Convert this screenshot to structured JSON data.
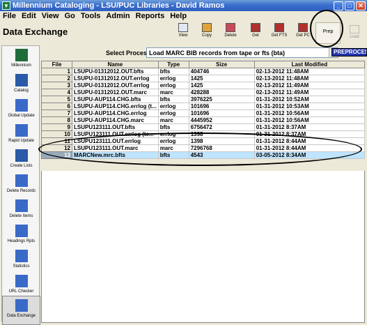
{
  "window": {
    "title": "Millennium Cataloging - LSU/PUC Libraries - David Ramos",
    "min": "_",
    "max": "□",
    "close": "✕"
  },
  "menu": [
    "File",
    "Edit",
    "View",
    "Go",
    "Tools",
    "Admin",
    "Reports",
    "Help"
  ],
  "page_title": "Data Exchange",
  "toolbar": [
    {
      "label": "View",
      "color": "#dfe8f4"
    },
    {
      "label": "Copy",
      "color": "#e0a33a"
    },
    {
      "label": "Delete",
      "color": "#c84a5a"
    },
    {
      "label": "Get",
      "color": "#b03030"
    },
    {
      "label": "Get FTS",
      "color": "#b03030"
    },
    {
      "label": "Get PC",
      "color": "#b03030"
    }
  ],
  "prep_label": "Prep",
  "load_label": "Load",
  "select_process": {
    "label": "Select Process",
    "value": "Load MARC BIB records from tape or fts (bta)"
  },
  "preprocess_badge": "PREPROCESS",
  "sidebar": [
    {
      "label": "Millennium",
      "color": "#1f6b3a"
    },
    {
      "label": "Catalog",
      "color": "#2a5aa8"
    },
    {
      "label": "Global Update",
      "color": "#3a6ac8"
    },
    {
      "label": "Rapid Update",
      "color": "#3a6ac8"
    },
    {
      "label": "Create Lists",
      "color": "#2a5aa8"
    },
    {
      "label": "Delete Records",
      "color": "#3a6ac8"
    },
    {
      "label": "Delete Items",
      "color": "#3a6ac8"
    },
    {
      "label": "Headings Rpts",
      "color": "#3a6ac8"
    },
    {
      "label": "Statistics",
      "color": "#3a6ac8"
    },
    {
      "label": "URL Checker",
      "color": "#3a6ac8"
    },
    {
      "label": "Data Exchange",
      "color": "#3a6ac8"
    }
  ],
  "table": {
    "headers": [
      "File",
      "Name",
      "Type",
      "Size",
      "Last Modified"
    ],
    "rows": [
      [
        "1",
        "LSUPU-01312012.OUT.bfts",
        "bfts",
        "404746",
        "02-13-2012 11:48AM"
      ],
      [
        "2",
        "LSUPU-01312012.OUT.errlog",
        "errlog",
        "1425",
        "02-13-2012 11:48AM"
      ],
      [
        "3",
        "LSUPU-01312012.OUT.errlog",
        "errlog",
        "1425",
        "02-13-2012 11:49AM"
      ],
      [
        "4",
        "LSUPU-01312012.OUT.marc",
        "marc",
        "428288",
        "02-13-2012 11:49AM"
      ],
      [
        "5",
        "LSUPU-AUP114.CHG.bfts",
        "bfts",
        "3976225",
        "01-31-2012 10:52AM"
      ],
      [
        "6",
        "LSUPU-AUP114.CHG.errlog (t...",
        "errlog",
        "101696",
        "01-31-2012 10:53AM"
      ],
      [
        "7",
        "LSUPU-AUP114.CHG.errlog",
        "errlog",
        "101696",
        "01-31-2012 10:56AM"
      ],
      [
        "8",
        "LSUPU-AUP114.CHG.marc",
        "marc",
        "4445952",
        "01-31-2012 10:56AM"
      ],
      [
        "9",
        "LSUPU123111.OUT.bfts",
        "bfts",
        "6756472",
        "01-31-2012 8:37AM"
      ],
      [
        "10",
        "LSUPU123111.OUT.errlog (te...",
        "errlog",
        "1398",
        "01-31-2012 8:37AM"
      ],
      [
        "11",
        "LSUPU123111.OUT.errlog",
        "errlog",
        "1398",
        "01-31-2012 8:44AM"
      ],
      [
        "12",
        "LSUPU123111.OUT.marc",
        "marc",
        "7296768",
        "01-31-2012 8:44AM"
      ],
      [
        "13",
        "MARCNew.mrc.bfts",
        "bfts",
        "4543",
        "03-05-2012 8:34AM"
      ]
    ],
    "selected_row": 13
  }
}
